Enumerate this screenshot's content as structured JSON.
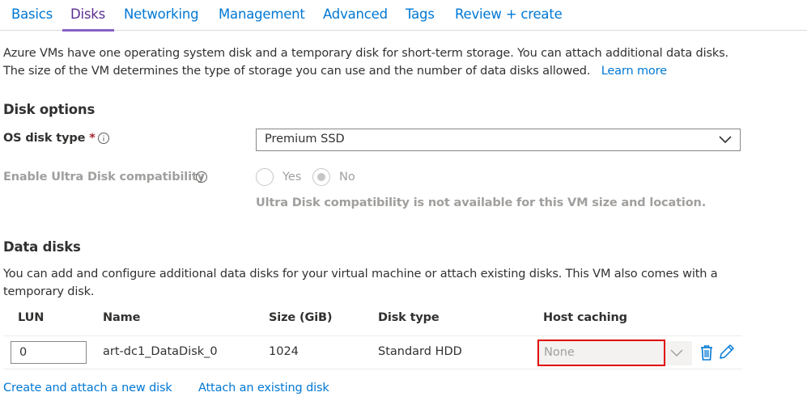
{
  "tabs": [
    {
      "label": "Basics"
    },
    {
      "label": "Disks"
    },
    {
      "label": "Networking"
    },
    {
      "label": "Management"
    },
    {
      "label": "Advanced"
    },
    {
      "label": "Tags"
    },
    {
      "label": "Review + create"
    }
  ],
  "intro": {
    "line1": "Azure VMs have one operating system disk and a temporary disk for short-term storage. You can attach additional data disks.",
    "line2": "The size of the VM determines the type of storage you can use and the number of data disks allowed.",
    "learn_more": "Learn more"
  },
  "disk_options": {
    "heading": "Disk options",
    "os_disk_type_label": "OS disk type",
    "required_marker": "*",
    "os_disk_type_value": "Premium SSD",
    "ultra_label": "Enable Ultra Disk compatibility",
    "ultra_yes": "Yes",
    "ultra_no": "No",
    "ultra_note": "Ultra Disk compatibility is not available for this VM size and location."
  },
  "data_disks": {
    "heading": "Data disks",
    "desc_line1": "You can add and configure additional data disks for your virtual machine or attach existing disks. This VM also comes with a",
    "desc_line2": "temporary disk.",
    "columns": [
      "LUN",
      "Name",
      "Size (GiB)",
      "Disk type",
      "Host caching"
    ],
    "rows": [
      {
        "lun": "0",
        "name": "art-dc1_DataDisk_0",
        "size": "1024",
        "disk_type": "Standard HDD",
        "host_caching": "None"
      }
    ],
    "create_link": "Create and attach a new disk",
    "attach_link": "Attach an existing disk"
  },
  "colors": {
    "link": "#0078d4",
    "active_tab": "#5c2d91",
    "highlight": "#e00000"
  }
}
